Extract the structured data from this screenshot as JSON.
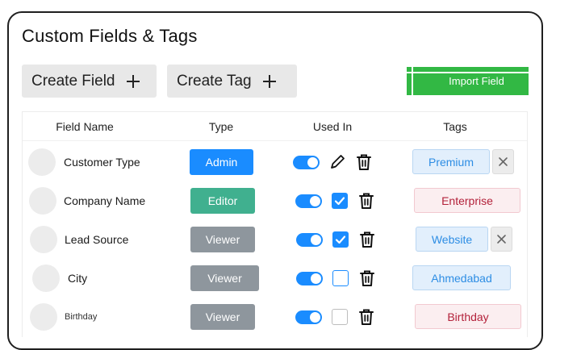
{
  "title": "Custom Fields & Tags",
  "toolbar": {
    "create_field_label": "Create Field",
    "create_tag_label": "Create Tag",
    "import_field_label": "Import Field"
  },
  "table": {
    "headers": [
      "Field Name",
      "Type",
      "Used In",
      "Tags"
    ],
    "rows": [
      {
        "name": "Customer Type",
        "type": "Admin",
        "used_in_mode": "edit",
        "tag": "Premium",
        "tag_style": "blue",
        "removable": true
      },
      {
        "name": "Company Name",
        "type": "Editor",
        "used_in_mode": "checked",
        "tag": "Enterprise",
        "tag_style": "pink",
        "removable": false
      },
      {
        "name": "Lead Source",
        "type": "Viewer",
        "used_in_mode": "checked",
        "tag": "Website",
        "tag_style": "blue",
        "removable": true
      },
      {
        "name": "City",
        "type": "Viewer",
        "used_in_mode": "unchecked",
        "tag": "Ahmedabad",
        "tag_style": "blue",
        "removable": false
      },
      {
        "name": "Birthday",
        "type": "Viewer",
        "used_in_mode": "unchecked",
        "tag": "Birthday",
        "tag_style": "pink",
        "removable": false
      }
    ]
  },
  "colors": {
    "admin": "#1a8cff",
    "editor": "#40b08f",
    "viewer": "#8e969d",
    "toggle_on": "#1a8cff",
    "import_button": "#32b844",
    "tag_blue_bg": "#e2effc",
    "tag_blue_text": "#2d8de4",
    "tag_pink_bg": "#fbeef0",
    "tag_pink_text": "#b3213a"
  },
  "icons": [
    "plus-icon",
    "pencil-icon",
    "trash-icon",
    "checkbox-icon",
    "close-icon",
    "toggle-switch"
  ]
}
